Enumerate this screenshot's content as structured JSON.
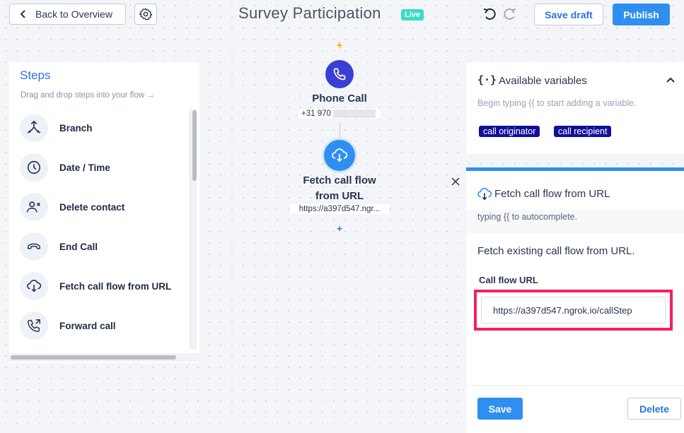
{
  "header": {
    "back_label": "Back to Overview",
    "flow_title": "Survey Participation",
    "status_badge": "Live",
    "save_draft_label": "Save draft",
    "publish_label": "Publish"
  },
  "steps_panel": {
    "title": "Steps",
    "subtitle": "Drag and drop steps into your flow →",
    "items": [
      {
        "label": "Branch",
        "icon": "branch-icon"
      },
      {
        "label": "Date / Time",
        "icon": "clock-icon"
      },
      {
        "label": "Delete contact",
        "icon": "delete-contact-icon"
      },
      {
        "label": "End Call",
        "icon": "end-call-icon"
      },
      {
        "label": "Fetch call flow from URL",
        "icon": "cloud-download-icon"
      },
      {
        "label": "Forward call",
        "icon": "forward-call-icon"
      }
    ]
  },
  "canvas": {
    "trigger_node": {
      "title": "Phone Call",
      "subtitle": "+31 970"
    },
    "fetch_node": {
      "title": "Fetch call flow from URL",
      "subtitle": "https://a397d547.ngr..."
    },
    "add_step_symbol": "+"
  },
  "variables_panel": {
    "icon_text": "{·}",
    "title": "Available variables",
    "hint": "Begin typing {{ to start adding a variable.",
    "chips": [
      "call originator",
      "call recipient"
    ]
  },
  "config_panel": {
    "title": "Fetch call flow from URL",
    "hint": "typing {{ to autocomplete.",
    "description": "Fetch existing call flow from URL.",
    "url_label": "Call flow URL",
    "url_value": "https://a397d547.ngrok.io/callStep",
    "save_label": "Save",
    "delete_label": "Delete"
  },
  "colors": {
    "accent": "#2f8ff0",
    "live_badge": "#3ddbc2",
    "chip_bg": "#12109a",
    "highlight_border": "#f2225e",
    "trigger_node": "#3a3fd4"
  }
}
